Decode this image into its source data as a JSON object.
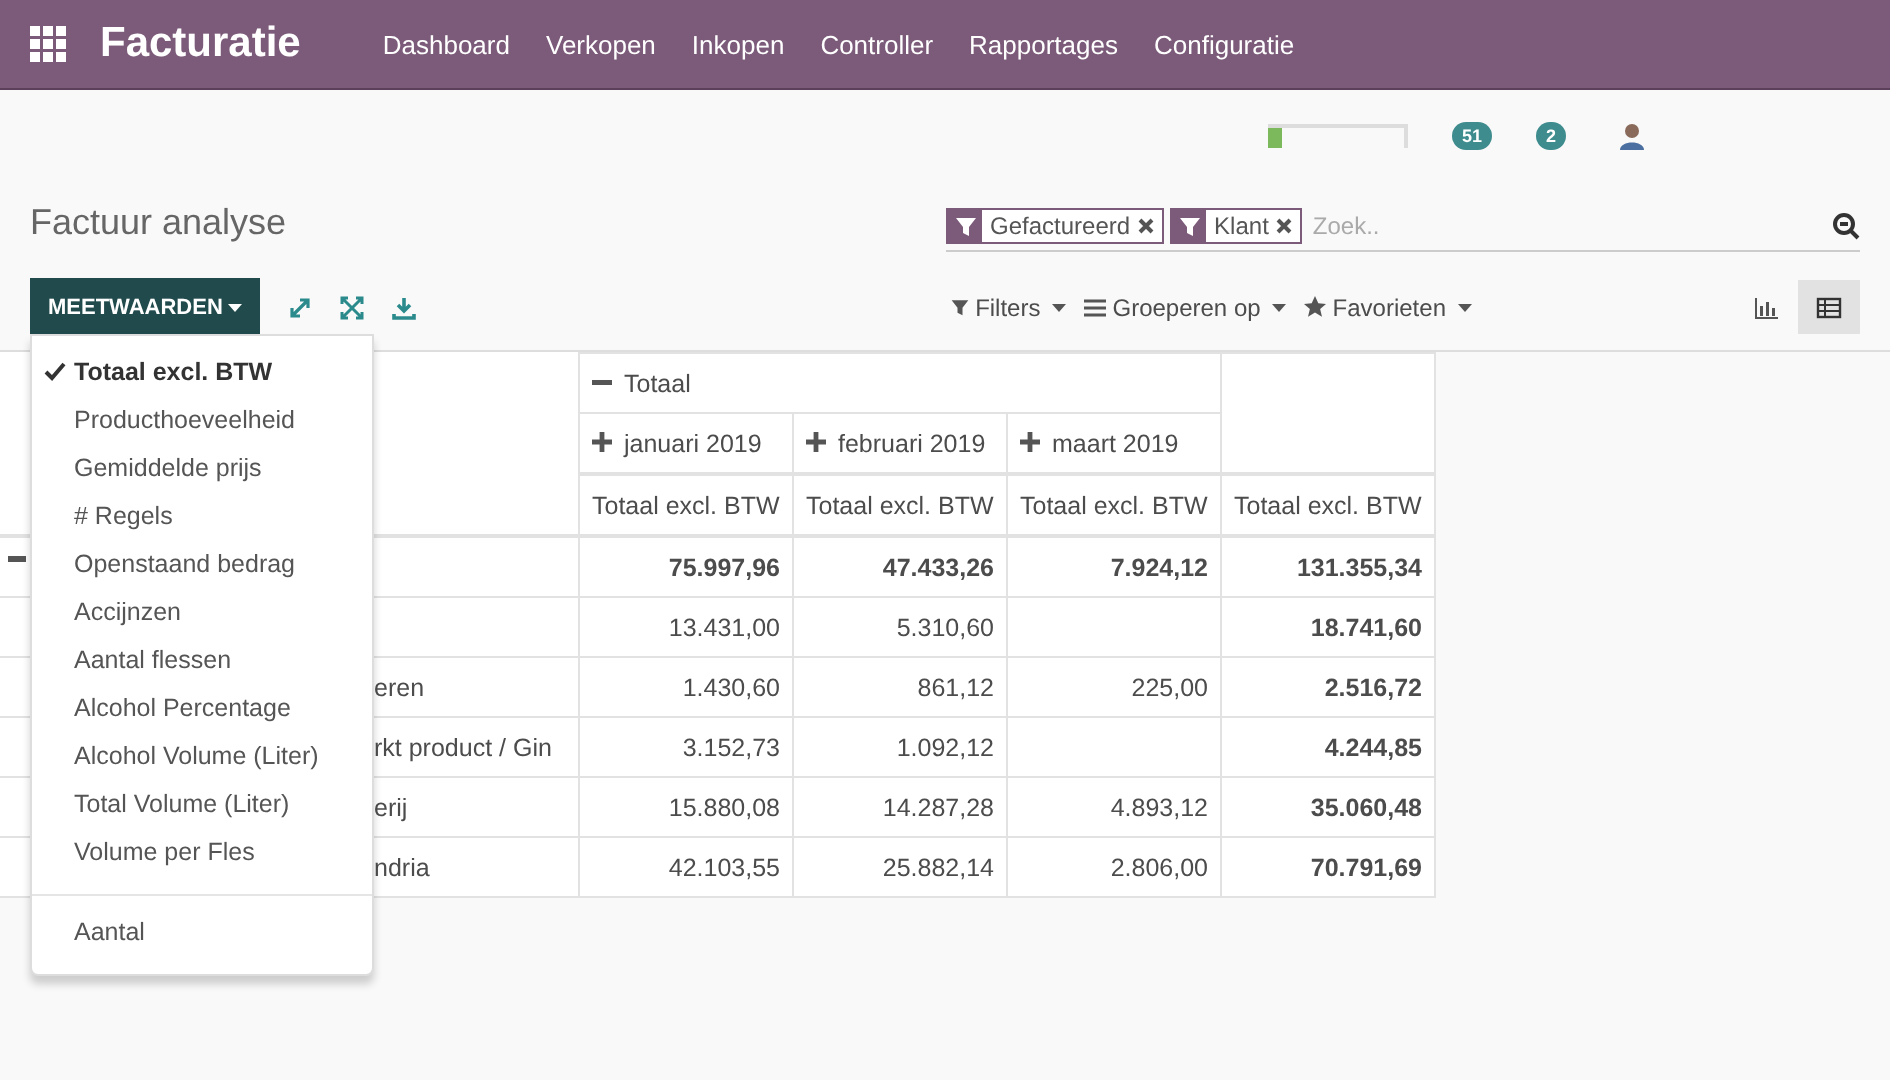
{
  "app": {
    "title": "Facturatie"
  },
  "menu": [
    {
      "label": "Dashboard"
    },
    {
      "label": "Verkopen"
    },
    {
      "label": "Inkopen"
    },
    {
      "label": "Controller"
    },
    {
      "label": "Rapportages"
    },
    {
      "label": "Configuratie"
    }
  ],
  "systray": {
    "progress": {
      "level": 0.1
    },
    "badges": [
      {
        "count": "51"
      },
      {
        "count": "2"
      }
    ]
  },
  "page_title": "Factuur analyse",
  "search": {
    "facets": [
      {
        "label": "Gefactureerd"
      },
      {
        "label": "Klant"
      }
    ],
    "placeholder": "Zoek.."
  },
  "measures_button": "MEETWAARDEN",
  "search_options": [
    {
      "label": "Filters"
    },
    {
      "label": "Groeperen op"
    },
    {
      "label": "Favorieten"
    }
  ],
  "views": [
    {
      "kind": "graph",
      "selected": false
    },
    {
      "kind": "pivot",
      "selected": true
    }
  ],
  "measures_menu": [
    {
      "label": "Totaal excl. BTW",
      "checked": true
    },
    {
      "label": "Producthoeveelheid",
      "checked": false
    },
    {
      "label": "Gemiddelde prijs",
      "checked": false
    },
    {
      "label": "# Regels",
      "checked": false
    },
    {
      "label": "Openstaand bedrag",
      "checked": false
    },
    {
      "label": "Accijnzen",
      "checked": false
    },
    {
      "label": "Aantal flessen",
      "checked": false
    },
    {
      "label": "Alcohol Percentage",
      "checked": false
    },
    {
      "label": "Alcohol Volume (Liter)",
      "checked": false
    },
    {
      "label": "Total Volume (Liter)",
      "checked": false
    },
    {
      "label": "Volume per Fles",
      "checked": false
    }
  ],
  "measures_extra": [
    {
      "label": "Aantal",
      "checked": false
    }
  ],
  "pivot": {
    "column_group": {
      "label": "Totaal",
      "expanded": true
    },
    "columns": [
      {
        "label": "januari 2019",
        "expanded": false
      },
      {
        "label": "februari 2019",
        "expanded": false
      },
      {
        "label": "maart 2019",
        "expanded": false
      }
    ],
    "measure_headers": [
      "Totaal excl. BTW",
      "Totaal excl. BTW",
      "Totaal excl. BTW",
      "Totaal excl. BTW"
    ],
    "rows": [
      {
        "kind": "total",
        "values": {
          "col_1": "75.997,96",
          "col_2": "47.433,26",
          "col_3": "7.924,12",
          "total": "131.355,34"
        }
      },
      {
        "kind": "group",
        "values": {
          "col_1": "13.431,00",
          "col_2": "5.310,60",
          "total": "18.741,60"
        }
      },
      {
        "kind": "group",
        "header": "eren",
        "values": {
          "col_1": "1.430,60",
          "col_2": "861,12",
          "col_3": "225,00",
          "total": "2.516,72"
        }
      },
      {
        "kind": "group",
        "header": "rkt product / Gin",
        "values": {
          "col_1": "3.152,73",
          "col_2": "1.092,12",
          "total": "4.244,85"
        }
      },
      {
        "kind": "group",
        "header": "erij",
        "values": {
          "col_1": "15.880,08",
          "col_2": "14.287,28",
          "col_3": "4.893,12",
          "total": "35.060,48"
        }
      },
      {
        "kind": "group",
        "header": "ndria",
        "values": {
          "col_1": "42.103,55",
          "col_2": "25.882,14",
          "col_3": "2.806,00",
          "total": "70.791,69"
        }
      }
    ]
  }
}
